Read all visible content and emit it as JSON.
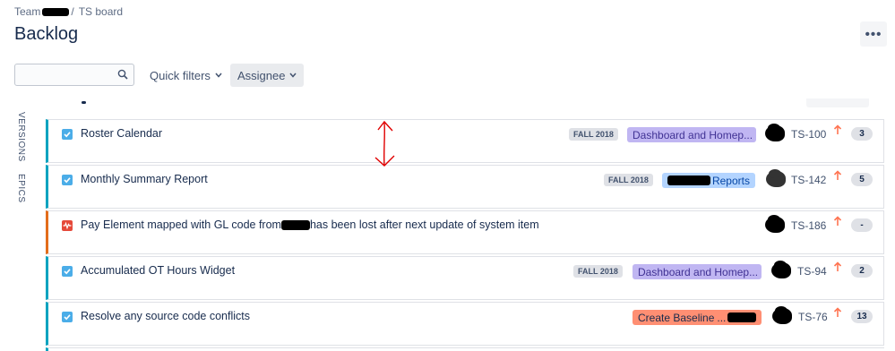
{
  "breadcrumb": {
    "team": "Team",
    "board": "TS board"
  },
  "page": {
    "title": "Backlog",
    "more_label": "•••"
  },
  "toolbar": {
    "search_value": "",
    "quick_filters_label": "Quick filters",
    "assignee_label": "Assignee"
  },
  "side": {
    "versions_label": "VERSIONS",
    "epics_label": "EPICS"
  },
  "issues": [
    {
      "summary": "Roster Calendar",
      "version": "FALL 2018",
      "epic": "Dashboard and Homep...",
      "key": "TS-100",
      "estimate": "3"
    },
    {
      "summary": "Monthly Summary Report",
      "version": "FALL 2018",
      "epic": "Reports",
      "key": "TS-142",
      "estimate": "5"
    },
    {
      "summary_before": "Pay Element mapped with GL code from ",
      "summary_after": "has been lost after next update of system item",
      "key": "TS-186",
      "estimate": "-"
    },
    {
      "summary": "Accumulated OT Hours Widget",
      "version": "FALL 2018",
      "epic": "Dashboard and Homep...",
      "key": "TS-94",
      "estimate": "2"
    },
    {
      "summary": "Resolve any source code conflicts",
      "epic": "Create Baseline",
      "key": "TS-76",
      "estimate": "13"
    }
  ],
  "colors": {
    "story_border": "#00a3bf",
    "bug_border": "#e36d1b",
    "priority": "#ff7452",
    "annotation": "#e00000"
  },
  "icons": {
    "story_type": "checkbox-check-icon",
    "bug_type": "bug-pulse-icon",
    "priority": "arrow-up-icon",
    "search": "search-icon"
  }
}
